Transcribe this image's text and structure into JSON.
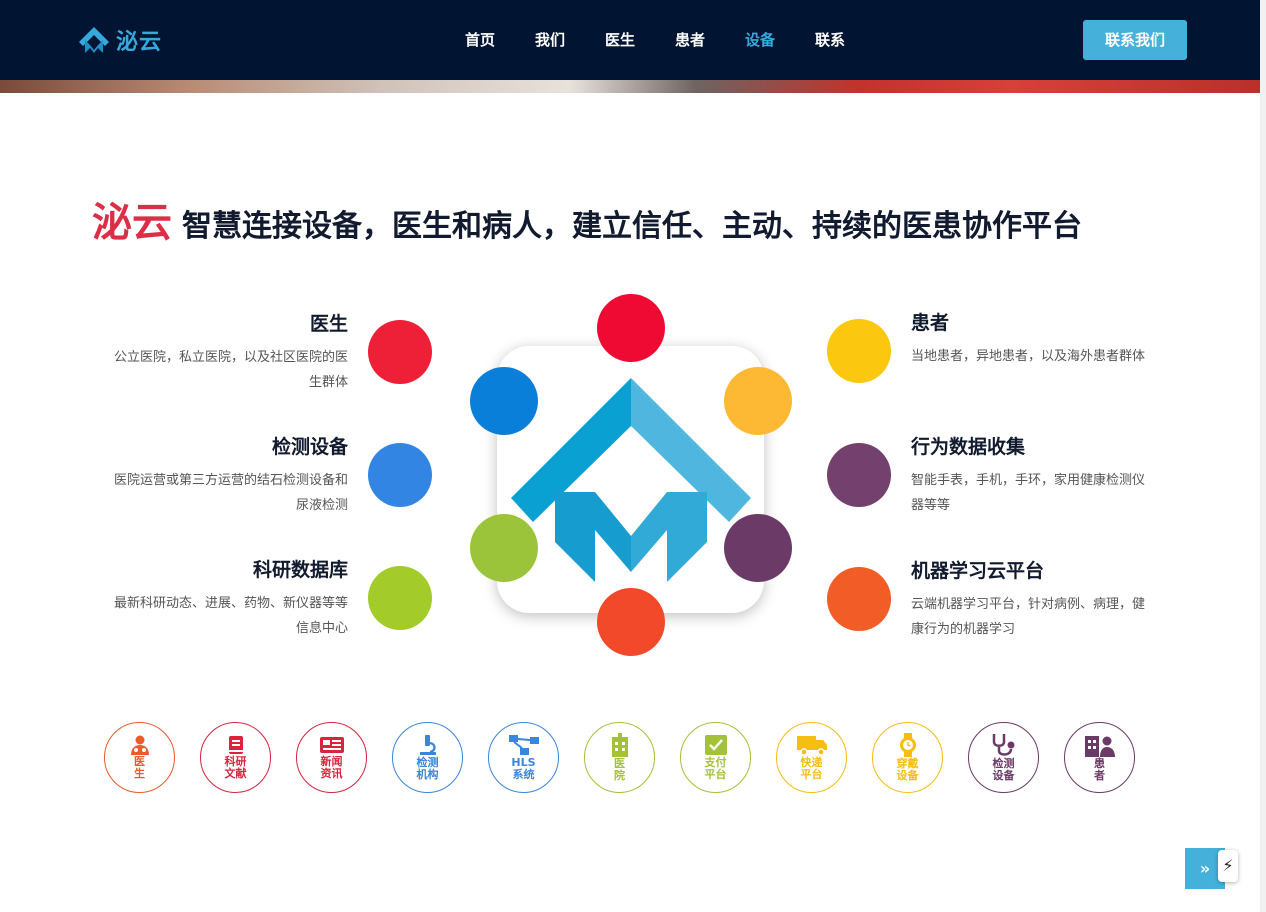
{
  "header": {
    "brand_name": "泌云",
    "nav": [
      {
        "label": "首页"
      },
      {
        "label": "我们"
      },
      {
        "label": "医生"
      },
      {
        "label": "患者"
      },
      {
        "label": "设备",
        "active": true
      },
      {
        "label": "联系"
      }
    ],
    "contact_button": "联系我们"
  },
  "headline": {
    "brand": "泌云",
    "text": "智慧连接设备，医生和病人，建立信任、主动、持续的医患协作平台"
  },
  "features_left": [
    {
      "title": "医生",
      "desc": "公立医院，私立医院，以及社区医院的医生群体",
      "color": "#ee2038"
    },
    {
      "title": "检测设备",
      "desc": "医院运营或第三方运营的结石检测设备和尿液检测",
      "color": "#3385e4"
    },
    {
      "title": "科研数据库",
      "desc": "最新科研动态、进展、药物、新仪器等等信息中心",
      "color": "#a3cc2a"
    }
  ],
  "features_right": [
    {
      "title": "患者",
      "desc": "当地患者，异地患者，以及海外患者群体",
      "color": "#fbc70f"
    },
    {
      "title": "行为数据收集",
      "desc": "智能手表，手机，手环，家用健康检测仪器等等",
      "color": "#74406e"
    },
    {
      "title": "机器学习云平台",
      "desc": "云端机器学习平台，针对病例、病理，健康行为的机器学习",
      "color": "#f25c26"
    }
  ],
  "orbit_colors": [
    "#ef0a33",
    "#fdb834",
    "#6b3a66",
    "#f2492a",
    "#9cc43a",
    "#0a7fd9"
  ],
  "icons": [
    {
      "label": "医\n生",
      "icon": "doctor-icon",
      "color": "#ea5b2e"
    },
    {
      "label": "科研\n文献",
      "icon": "book-icon",
      "color": "#d8243c"
    },
    {
      "label": "新闻\n资讯",
      "icon": "newspaper-icon",
      "color": "#d8243c"
    },
    {
      "label": "检测\n机构",
      "icon": "microscope-icon",
      "color": "#3a86d9"
    },
    {
      "label": "HLS\n系统",
      "icon": "network-icon",
      "color": "#3a86d9"
    },
    {
      "label": "医\n院",
      "icon": "hospital-icon",
      "color": "#a3c23a"
    },
    {
      "label": "支付\n平台",
      "icon": "payment-icon",
      "color": "#a3c23a"
    },
    {
      "label": "快递\n平台",
      "icon": "truck-icon",
      "color": "#f6bd12"
    },
    {
      "label": "穿戴\n设备",
      "icon": "watch-icon",
      "color": "#f6bd12"
    },
    {
      "label": "检测\n设备",
      "icon": "stethoscope-icon",
      "color": "#6b3a66"
    },
    {
      "label": "患\n者",
      "icon": "patient-icon",
      "color": "#6b3a66"
    }
  ],
  "back_to_top": "»",
  "bolt": "⚡"
}
